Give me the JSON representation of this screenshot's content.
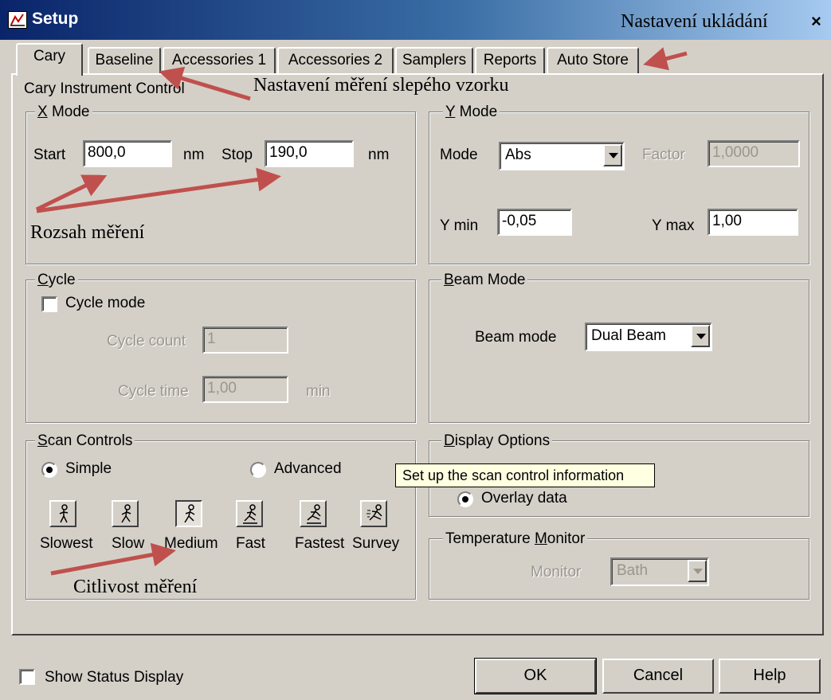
{
  "window": {
    "title": "Setup",
    "annotation_storage": "Nastavení ukládání",
    "close_glyph": "×"
  },
  "tabs": [
    {
      "label": "Cary",
      "active": true
    },
    {
      "label": "Baseline"
    },
    {
      "label": "Accessories 1"
    },
    {
      "label": "Accessories 2"
    },
    {
      "label": "Samplers"
    },
    {
      "label": "Reports"
    },
    {
      "label": "Auto Store"
    }
  ],
  "panel": {
    "caption": "Cary Instrument Control",
    "annotation_baseline": "Nastavení měření slepého vzorku"
  },
  "x_mode": {
    "legend_key": "X",
    "legend_rest": " Mode",
    "start_label": "Start",
    "start_value": "800,0",
    "start_unit": "nm",
    "stop_label": "Stop",
    "stop_value": "190,0",
    "stop_unit": "nm",
    "annotation": "Rozsah měření"
  },
  "y_mode": {
    "legend_key": "Y",
    "legend_rest": " Mode",
    "mode_label": "Mode",
    "mode_value": "Abs",
    "factor_label": "Factor",
    "factor_value": "1,0000",
    "ymin_label": "Y min",
    "ymin_value": "-0,05",
    "ymax_label": "Y max",
    "ymax_value": "1,00"
  },
  "cycle": {
    "legend_key": "C",
    "legend_rest": "ycle",
    "mode_label": "Cycle mode",
    "mode_checked": false,
    "count_label": "Cycle count",
    "count_value": "1",
    "time_label": "Cycle time",
    "time_value": "1,00",
    "time_unit": "min"
  },
  "beam": {
    "legend_key": "B",
    "legend_rest": "eam Mode",
    "label": "Beam mode",
    "value": "Dual Beam"
  },
  "scan": {
    "legend_key": "S",
    "legend_rest": "can Controls",
    "simple_label": "Simple",
    "advanced_label": "Advanced",
    "selected": "Simple",
    "speeds": [
      {
        "label": "Slowest",
        "icon": "walking-figure-icon"
      },
      {
        "label": "Slow",
        "icon": "walking-figure-icon"
      },
      {
        "label": "Medium",
        "icon": "walking-figure-icon",
        "pressed": true
      },
      {
        "label": "Fast",
        "icon": "running-figure-icon"
      },
      {
        "label": "Fastest",
        "icon": "running-figure-icon"
      },
      {
        "label": "Survey",
        "icon": "sprinting-figure-icon"
      }
    ],
    "annotation": "Citlivost měření",
    "tooltip": "Set up the scan control information"
  },
  "display": {
    "legend_key": "D",
    "legend_rest": "isplay Options",
    "overlay_label": "Overlay data",
    "overlay_selected": true
  },
  "temperature": {
    "legend_pre": "Temperature ",
    "legend_key": "M",
    "legend_rest": "onitor",
    "monitor_label": "Monitor",
    "monitor_value": "Bath"
  },
  "footer": {
    "status_label": "Show Status Display",
    "status_checked": false,
    "ok_label": "OK",
    "cancel_label": "Cancel",
    "help_label": "Help"
  },
  "colors": {
    "dialog_bg": "#d4d0c8",
    "titlebar_start": "#0a246a",
    "titlebar_end": "#a6caf0",
    "annotation_arrow": "#c0504d",
    "tooltip_bg": "#ffffe1"
  }
}
